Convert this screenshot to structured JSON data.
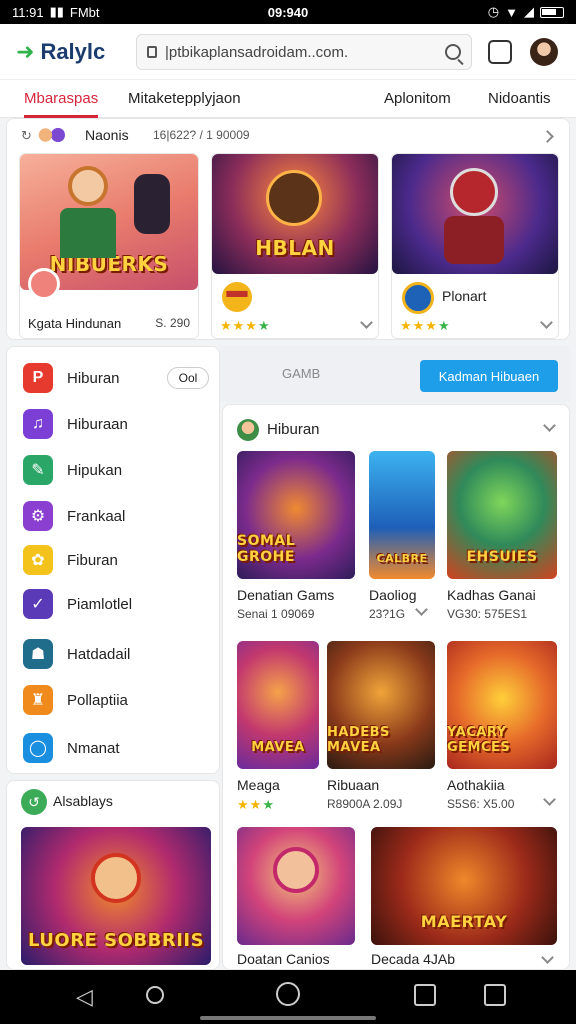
{
  "status": {
    "left": "11:91",
    "carrier": "FMbt",
    "time": "09:940"
  },
  "app": {
    "title": "Ralylc"
  },
  "address": {
    "value": "|ptbikaplansadroidam..com."
  },
  "tabs": [
    {
      "label": "Mbaraspas"
    },
    {
      "label": "Mitaketepplyjaon"
    },
    {
      "label": "Aplonitom"
    },
    {
      "label": "Nidoantis"
    }
  ],
  "featured": {
    "header": "Naonis",
    "meta": "16|622? / 1 90009",
    "cards": [
      {
        "title": "NIBUERKS",
        "name": "Kgata Hindunan",
        "price": "S. 290"
      },
      {
        "title": "HBLAN",
        "badge": "▀▀▀"
      },
      {
        "title": "",
        "name": "Plonart"
      }
    ]
  },
  "sidebar": {
    "items": [
      {
        "label": "Hiburan",
        "pill": "Ool",
        "color": "#e63a2f",
        "icon": "P"
      },
      {
        "label": "Hiburaan",
        "color": "#7b3fd6",
        "icon": "♫"
      },
      {
        "label": "Hipukan",
        "color": "#2aa667",
        "icon": "✎"
      },
      {
        "label": "Frankaal",
        "color": "#8b3fd0",
        "icon": "⚙"
      },
      {
        "label": "Fiburan",
        "color": "#f3c21b",
        "icon": "✿"
      },
      {
        "label": "Piamlotlel",
        "color": "#5b3ab8",
        "icon": "✓"
      },
      {
        "label": "Hatdadail",
        "color": "#1f6d8a",
        "icon": "☗"
      },
      {
        "label": "Pollaptiia",
        "color": "#f08a1c",
        "icon": "♜"
      },
      {
        "label": "Nmanat",
        "color": "#1a8fe0",
        "icon": "◯"
      }
    ],
    "section": {
      "label": "Alsablays"
    }
  },
  "right": {
    "gam_label": "GAMB",
    "cta": "Kadman Hibuaen",
    "section": "Hiburan",
    "grid": [
      {
        "title": "Denatian Gams",
        "sub": "Senai 1 09069",
        "art": "SOMAL GROHE"
      },
      {
        "title": "Daoliog",
        "sub": "23?1G",
        "art": "CALBRE"
      },
      {
        "title": "Kadhas Ganai",
        "sub": "VG30: 575ES1",
        "art": "EHSUIES"
      },
      {
        "title": "Meaga",
        "sub": "",
        "art": "MAVEA"
      },
      {
        "title": "Ribuaan",
        "sub": "R8900A 2.09J",
        "art": "HADEBS MAVEA"
      },
      {
        "title": "Aothakiia",
        "sub": "S5S6: X5.00",
        "art": "YACARY GEMCES"
      },
      {
        "title": "Doatan Canios",
        "sub": "",
        "art": ""
      },
      {
        "title": "Decada 4JAb",
        "sub": "",
        "art": "MAERTAY"
      }
    ]
  },
  "promo": {
    "art": "LUORE SOBBRIIS"
  }
}
